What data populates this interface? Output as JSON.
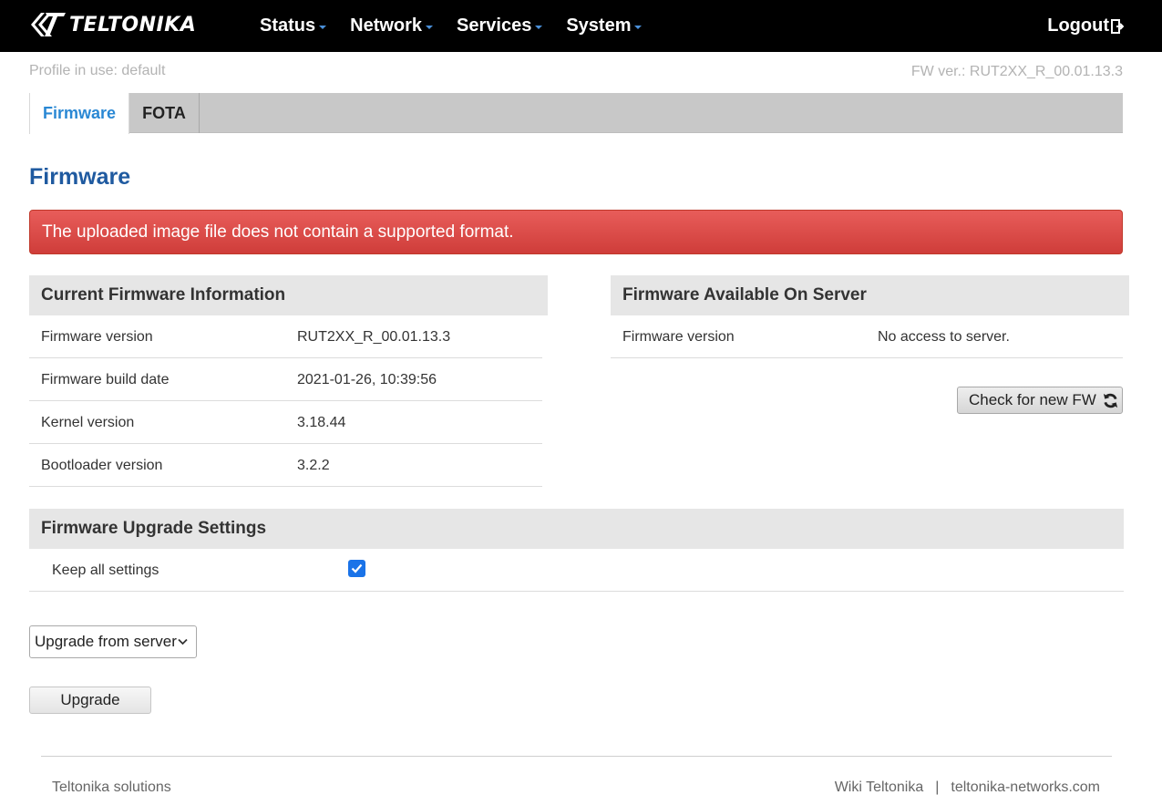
{
  "brand": {
    "logo_text": "TELTONIKA"
  },
  "nav": {
    "items": [
      {
        "label": "Status"
      },
      {
        "label": "Network"
      },
      {
        "label": "Services"
      },
      {
        "label": "System"
      }
    ],
    "logout_label": "Logout"
  },
  "info": {
    "profile_label": "Profile in use:",
    "profile_value": "default",
    "fw_label": "FW ver.:",
    "fw_value": "RUT2XX_R_00.01.13.3"
  },
  "tabs": [
    {
      "label": "Firmware",
      "active": true
    },
    {
      "label": "FOTA",
      "active": false
    }
  ],
  "page_title": "Firmware",
  "alert_text": "The uploaded image file does not contain a supported format.",
  "current_fw": {
    "title": "Current Firmware Information",
    "rows": [
      {
        "key": "Firmware version",
        "value": "RUT2XX_R_00.01.13.3"
      },
      {
        "key": "Firmware build date",
        "value": "2021-01-26, 10:39:56"
      },
      {
        "key": "Kernel version",
        "value": "3.18.44"
      },
      {
        "key": "Bootloader version",
        "value": "3.2.2"
      }
    ]
  },
  "server_fw": {
    "title": "Firmware Available On Server",
    "rows": [
      {
        "key": "Firmware version",
        "value": "No access to server."
      }
    ],
    "check_button_label": "Check for new FW"
  },
  "upgrade_settings": {
    "title": "Firmware Upgrade Settings",
    "keep_settings_label": "Keep all settings",
    "keep_settings_checked": true
  },
  "upgrade_source": {
    "selected": "Upgrade from server"
  },
  "upgrade_button_label": "Upgrade",
  "footer": {
    "left": "Teltonika solutions",
    "links": [
      "Wiki Teltonika",
      "teltonika-networks.com"
    ],
    "separator": "|"
  },
  "colors": {
    "topbar": "#000000",
    "accent_blue": "#2a88d4",
    "title_blue": "#1f5aa0",
    "alert_red": "#d9534f",
    "checkbox_blue": "#1a73e8"
  }
}
